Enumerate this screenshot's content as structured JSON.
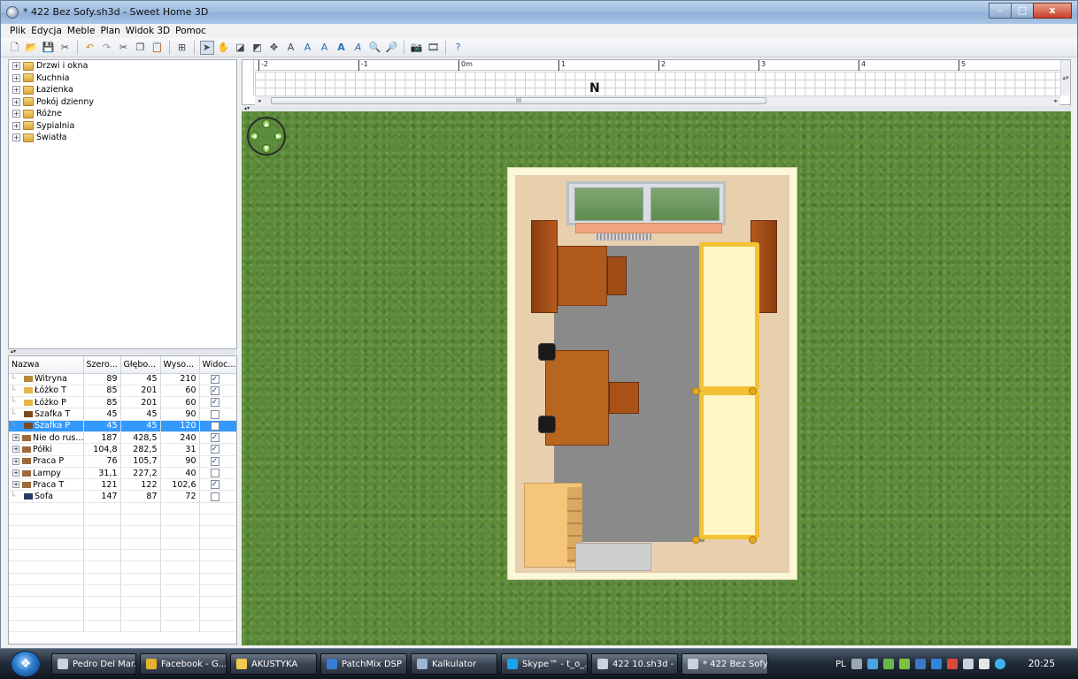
{
  "window": {
    "title": "* 422 Bez Sofy.sh3d - Sweet Home 3D",
    "minimize": "–",
    "maximize": "□",
    "close": "x"
  },
  "menu": [
    "Plik",
    "Edycja",
    "Meble",
    "Plan",
    "Widok 3D",
    "Pomoc"
  ],
  "toolbar": {
    "icons": [
      "new-file-icon",
      "open-file-icon",
      "save-file-icon",
      "cut-scissors-icon",
      "undo-icon",
      "redo-icon",
      "cut-icon",
      "copy-icon",
      "paste-icon",
      "add-furniture-icon",
      "select-mode-icon",
      "pan-mode-icon",
      "create-walls-icon",
      "create-rooms-icon",
      "create-dimensions-icon",
      "add-text-icon",
      "text-style-a-icon",
      "text-style-b-icon",
      "text-style-c-icon",
      "text-style-d-icon",
      "zoom-in-icon",
      "zoom-out-icon",
      "create-photo-icon",
      "create-video-icon",
      "help-icon"
    ]
  },
  "catalog": {
    "categories": [
      "Drzwi i okna",
      "Kuchnia",
      "Łazienka",
      "Pokój dzienny",
      "Różne",
      "Sypialnia",
      "Światła"
    ]
  },
  "furniture_table": {
    "columns": [
      "Nazwa",
      "Szero...",
      "Głębo...",
      "Wyso...",
      "Widoc..."
    ],
    "rows": [
      {
        "name": "Witryna",
        "w": "89",
        "d": "45",
        "h": "210",
        "visible": true,
        "group": false,
        "selected": false,
        "icon_color": "#b98a35"
      },
      {
        "name": "Łóżko T",
        "w": "85",
        "d": "201",
        "h": "60",
        "visible": true,
        "group": false,
        "selected": false,
        "icon_color": "#e5b648"
      },
      {
        "name": "Łóżko P",
        "w": "85",
        "d": "201",
        "h": "60",
        "visible": true,
        "group": false,
        "selected": false,
        "icon_color": "#e5b648"
      },
      {
        "name": "Szafka T",
        "w": "45",
        "d": "45",
        "h": "90",
        "visible": false,
        "group": false,
        "selected": false,
        "icon_color": "#7a4a1f"
      },
      {
        "name": "Szafka P",
        "w": "45",
        "d": "45",
        "h": "120",
        "visible": false,
        "group": false,
        "selected": true,
        "icon_color": "#7a4a1f"
      },
      {
        "name": "Nie do rus...",
        "w": "187",
        "d": "428,5",
        "h": "240",
        "visible": true,
        "group": true,
        "selected": false,
        "icon_color": "#9c6a3a"
      },
      {
        "name": "Półki",
        "w": "104,8",
        "d": "282,5",
        "h": "31",
        "visible": true,
        "group": true,
        "selected": false,
        "icon_color": "#9c6a3a"
      },
      {
        "name": "Praca P",
        "w": "76",
        "d": "105,7",
        "h": "90",
        "visible": true,
        "group": true,
        "selected": false,
        "icon_color": "#9c6a3a"
      },
      {
        "name": "Lampy",
        "w": "31,1",
        "d": "227,2",
        "h": "40",
        "visible": false,
        "group": true,
        "selected": false,
        "icon_color": "#9c6a3a"
      },
      {
        "name": "Praca T",
        "w": "121",
        "d": "122",
        "h": "102,6",
        "visible": true,
        "group": true,
        "selected": false,
        "icon_color": "#9c6a3a"
      },
      {
        "name": "Sofa",
        "w": "147",
        "d": "87",
        "h": "72",
        "visible": false,
        "group": false,
        "selected": false,
        "icon_color": "#2a3b66"
      }
    ]
  },
  "plan": {
    "ruler_labels": [
      "-2",
      "-1",
      "0m",
      "1",
      "2",
      "3",
      "4",
      "5"
    ],
    "north_label": "N",
    "scroll_thumb_label": "III"
  },
  "taskbar": {
    "start_glyph": "❖",
    "tasks": [
      {
        "label": "Pedro Del Mar...",
        "icon_color": "#c9d3de",
        "active": false
      },
      {
        "label": "Facebook - G...",
        "icon_color": "#e5b230",
        "active": false
      },
      {
        "label": "AKUSTYKA",
        "icon_color": "#f2c94c",
        "active": false
      },
      {
        "label": "PatchMix DSP",
        "icon_color": "#3a7bd5",
        "active": false
      },
      {
        "label": "Kalkulator",
        "icon_color": "#9fb6d1",
        "active": false
      },
      {
        "label": "Skype™ - t_o_...",
        "icon_color": "#1aa3e8",
        "active": false
      },
      {
        "label": "422 10.sh3d - ...",
        "icon_color": "#c9d3de",
        "active": false
      },
      {
        "label": "* 422 Bez Sofy...",
        "icon_color": "#c9d3de",
        "active": true
      }
    ],
    "language": "PL",
    "clock": "20:25"
  }
}
